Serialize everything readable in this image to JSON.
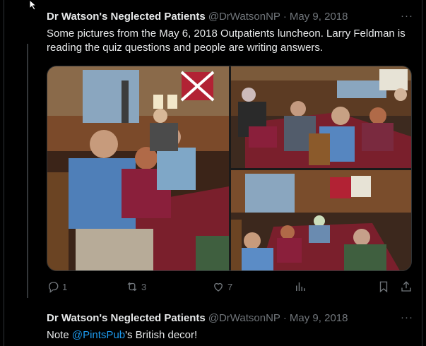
{
  "tweets": [
    {
      "name": "Dr Watson's Neglected Patients",
      "handle": "@DrWatsonNP",
      "separator": "·",
      "date": "May 9, 2018",
      "more": "···",
      "text": "Some pictures from the May 6, 2018 Outpatients luncheon. Larry Feldman is reading the quiz questions and people are writing answers.",
      "actions": {
        "replies": "1",
        "retweets": "3",
        "likes": "7"
      }
    },
    {
      "name": "Dr Watson's Neglected Patients",
      "handle": "@DrWatsonNP",
      "separator": "·",
      "date": "May 9, 2018",
      "more": "···",
      "text_before": "Note ",
      "mention": "@PintsPub",
      "text_after": "'s British decor!"
    }
  ],
  "icons": {
    "reply": "reply-icon",
    "retweet": "retweet-icon",
    "like": "heart-icon",
    "views": "views-icon",
    "bookmark": "bookmark-icon",
    "share": "share-icon"
  },
  "colors": {
    "background": "#000000",
    "text": "#e7e9ea",
    "muted": "#71767b",
    "link": "#1d9bf0",
    "border": "#2f3336"
  }
}
